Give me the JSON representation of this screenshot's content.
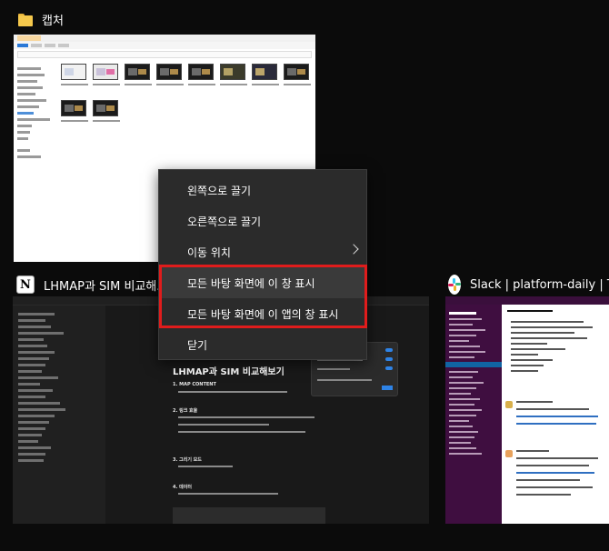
{
  "windows": [
    {
      "title": "캡처",
      "icon": "folder-icon"
    },
    {
      "title": "LHMAP과 SIM 비교해보기",
      "icon": "notion-icon"
    },
    {
      "title": "Slack | platform-daily | TEN",
      "icon": "slack-icon"
    }
  ],
  "notion_page": {
    "title": "LHMAP과 SIM 비교해보기",
    "headings": [
      "1. MAP CONTENT",
      "2. 링크 효율",
      "3. 그리기 모드",
      "4. 데이터"
    ]
  },
  "slack": {
    "workspace": "TENELEVEN",
    "channel": "platform-daily"
  },
  "context_menu": {
    "items": [
      {
        "label": "왼쪽으로 끌기"
      },
      {
        "label": "오른쪽으로 끌기"
      },
      {
        "label": "이동 위치",
        "submenu": true
      },
      {
        "label": "모든 바탕 화면에 이 창 표시"
      },
      {
        "label": "모든 바탕 화면에 이 앱의 창 표시"
      },
      {
        "label": "닫기"
      }
    ],
    "highlight_color": "#e01c1c"
  }
}
